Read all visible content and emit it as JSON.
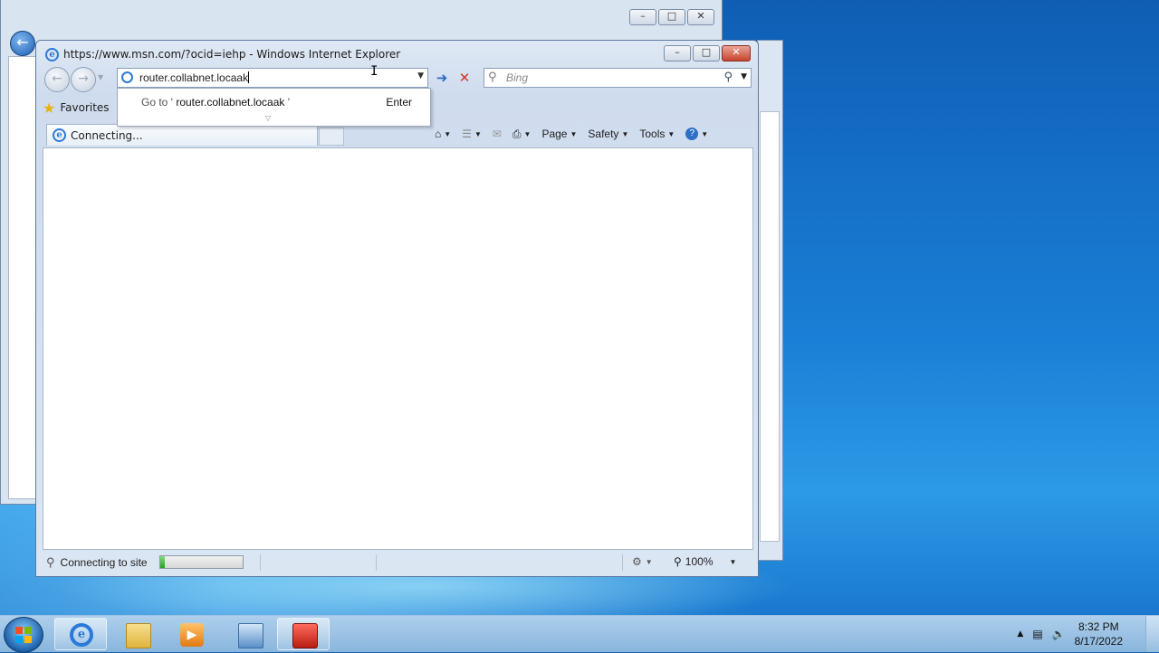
{
  "ie_window": {
    "title": "https://www.msn.com/?ocid=iehp - Windows Internet Explorer",
    "address_value": "router.collabnet.locaak",
    "search_placeholder": "Bing",
    "favorites_label": "Favorites",
    "tab_label": "Connecting...",
    "command_bar": {
      "page": "Page",
      "safety": "Safety",
      "tools": "Tools"
    },
    "autocomplete": {
      "goto_prefix": "Go to '",
      "url": "router.collabnet.locaak",
      "goto_suffix": " '",
      "enter_label": "Enter"
    },
    "status": {
      "text": "Connecting to site",
      "progress": 0.05,
      "zoom": "100%"
    }
  },
  "taskbar": {
    "time": "8:32 PM",
    "date": "8/17/2022"
  }
}
